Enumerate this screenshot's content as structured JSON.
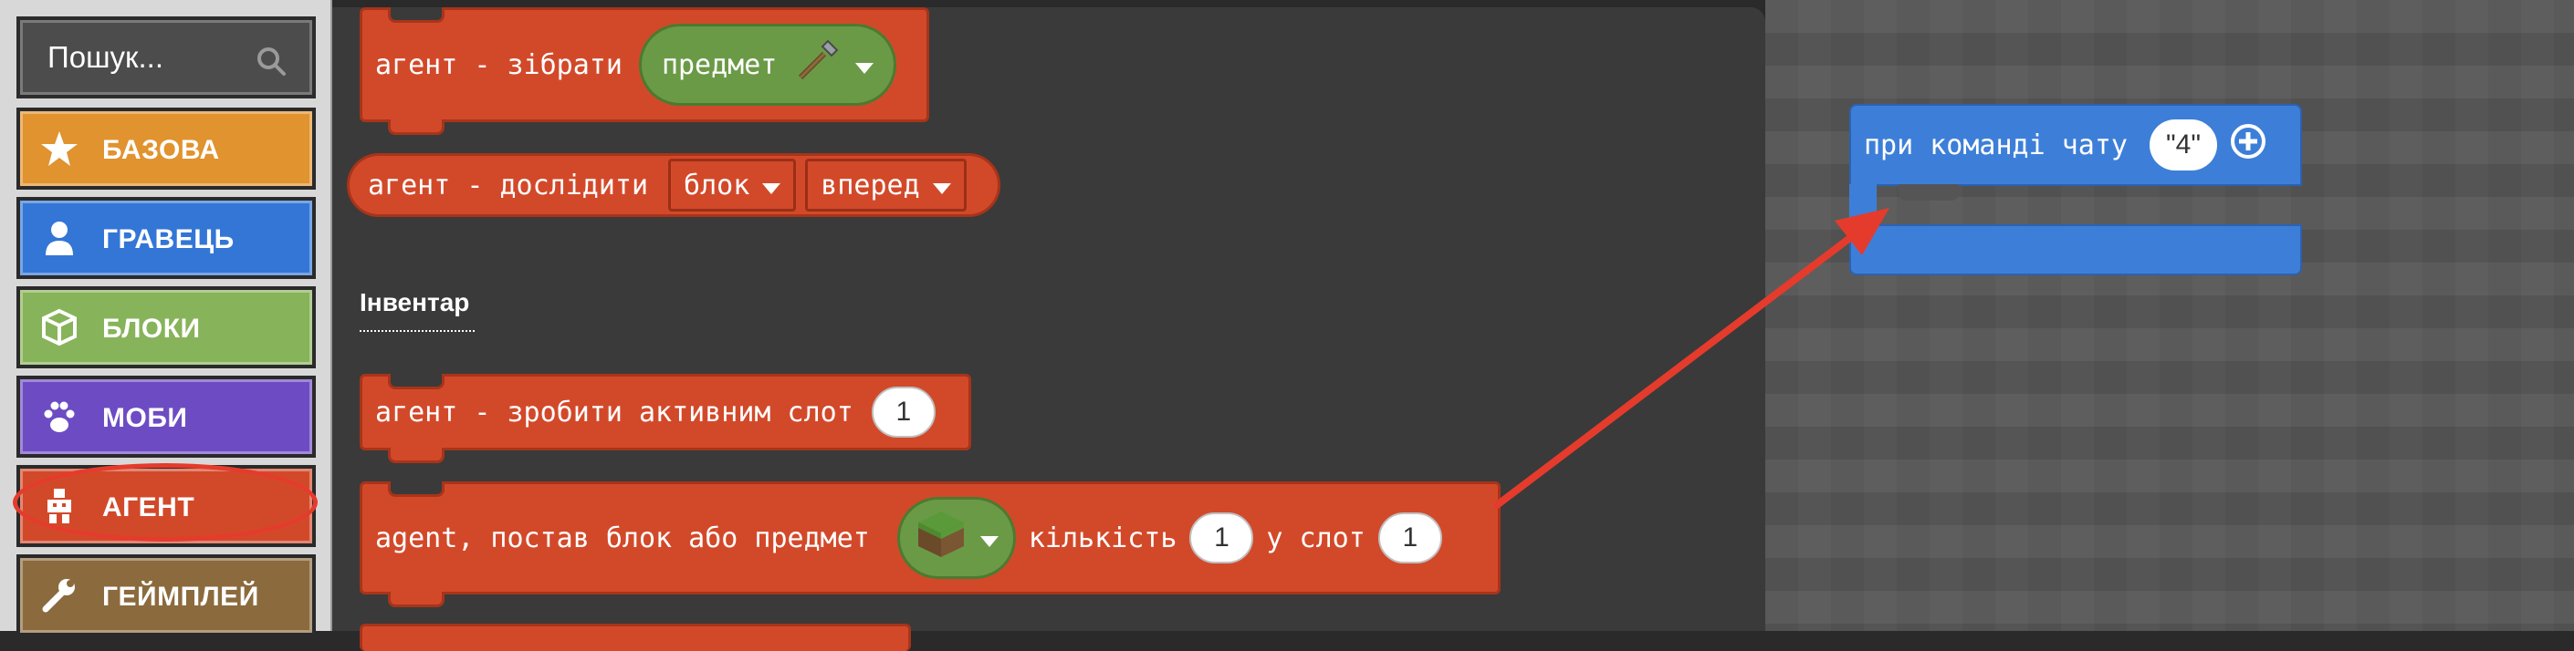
{
  "sidebar": {
    "search_placeholder": "Пошук...",
    "categories": [
      {
        "label": "БАЗОВА",
        "color": "#e0932e",
        "icon": "star-icon"
      },
      {
        "label": "ГРАВЕЦЬ",
        "color": "#3376d6",
        "icon": "player-icon"
      },
      {
        "label": "БЛОКИ",
        "color": "#87b35a",
        "icon": "cube-icon"
      },
      {
        "label": "МОБИ",
        "color": "#6d4cc3",
        "icon": "paw-icon"
      },
      {
        "label": "АГЕНТ",
        "color": "#d2492a",
        "icon": "agent-icon"
      },
      {
        "label": "ГЕЙМПЛЕЙ",
        "color": "#8b6a3d",
        "icon": "wrench-icon"
      }
    ]
  },
  "flyout": {
    "collect_block": {
      "text": "агент - зібрати",
      "item_label": "предмет"
    },
    "explore_block": {
      "text": "агент - дослідити",
      "dropdown1": "блок",
      "dropdown2": "вперед"
    },
    "inventory_heading": "Інвентар",
    "active_slot_block": {
      "text": "агент - зробити активним слот",
      "value": "1"
    },
    "place_item_block": {
      "text": "agent, постав блок або предмет",
      "amount_label": "кількість",
      "amount_value": "1",
      "slot_label": "у слот",
      "slot_value": "1"
    }
  },
  "workspace": {
    "chat_block": {
      "text": "при команді чату",
      "command": "\"4\""
    }
  },
  "colors": {
    "agent": "#d2492a",
    "player": "#3d7fd8",
    "annotation": "#e53b2c"
  }
}
